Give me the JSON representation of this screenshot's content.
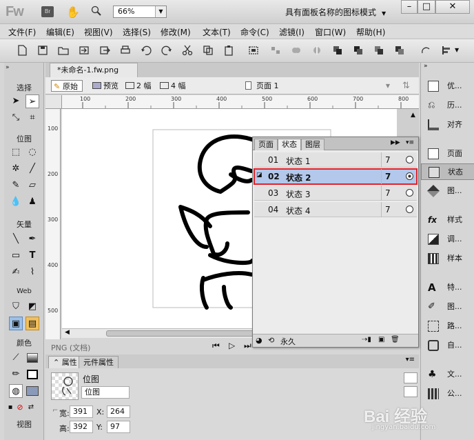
{
  "titlebar": {
    "logo": "Fw",
    "br_button": "Br",
    "zoom": "66%",
    "workspace_mode": "具有面板名称的图标模式"
  },
  "menu": [
    "文件(F)",
    "编辑(E)",
    "视图(V)",
    "选择(S)",
    "修改(M)",
    "文本(T)",
    "命令(C)",
    "滤镜(I)",
    "窗口(W)",
    "帮助(H)"
  ],
  "tools": {
    "section_select": "选择",
    "section_bitmap": "位图",
    "section_vector": "矢量",
    "section_web": "Web",
    "section_color": "颜色",
    "section_view": "视图"
  },
  "document": {
    "tab": "*未命名-1.fw.png",
    "view_original": "原始",
    "view_preview": "预览",
    "view_2up": "2 幅",
    "view_4up": "4 幅",
    "page": "页面 1",
    "status": "PNG (文档)",
    "ruler_h": [
      "100",
      "200",
      "300",
      "400",
      "500",
      "600",
      "700",
      "800"
    ],
    "ruler_v": [
      "100",
      "200",
      "300",
      "400",
      "500"
    ]
  },
  "states_panel": {
    "tabs": [
      "页面",
      "状态",
      "图层"
    ],
    "rows": [
      {
        "num": "01",
        "name": "状态 1",
        "delay": "7",
        "selected": false
      },
      {
        "num": "02",
        "name": "状态 2",
        "delay": "7",
        "selected": true
      },
      {
        "num": "03",
        "name": "状态 3",
        "delay": "7",
        "selected": false
      },
      {
        "num": "04",
        "name": "状态 4",
        "delay": "7",
        "selected": false
      }
    ],
    "loop": "永久"
  },
  "properties": {
    "tab_props": "属性",
    "tab_symbol": "元件属性",
    "type": "位图",
    "name_value": "位图",
    "w_label": "宽:",
    "w": "391",
    "x_label": "X:",
    "x": "264",
    "h_label": "高:",
    "h": "392",
    "y_label": "Y:",
    "y": "97"
  },
  "right_panel": [
    "优...",
    "历...",
    "对齐",
    "页面",
    "状态",
    "图...",
    "样式",
    "调...",
    "样本",
    "特...",
    "图...",
    "路...",
    "自...",
    "文...",
    "公..."
  ],
  "watermark": {
    "text": "Bai 经验",
    "url": "jingyan.baidu.com"
  },
  "colors": {
    "selection": "#b3c8ea",
    "highlight": "#e0222a",
    "stroke": "#000000",
    "fill": "#8a9ab8"
  }
}
